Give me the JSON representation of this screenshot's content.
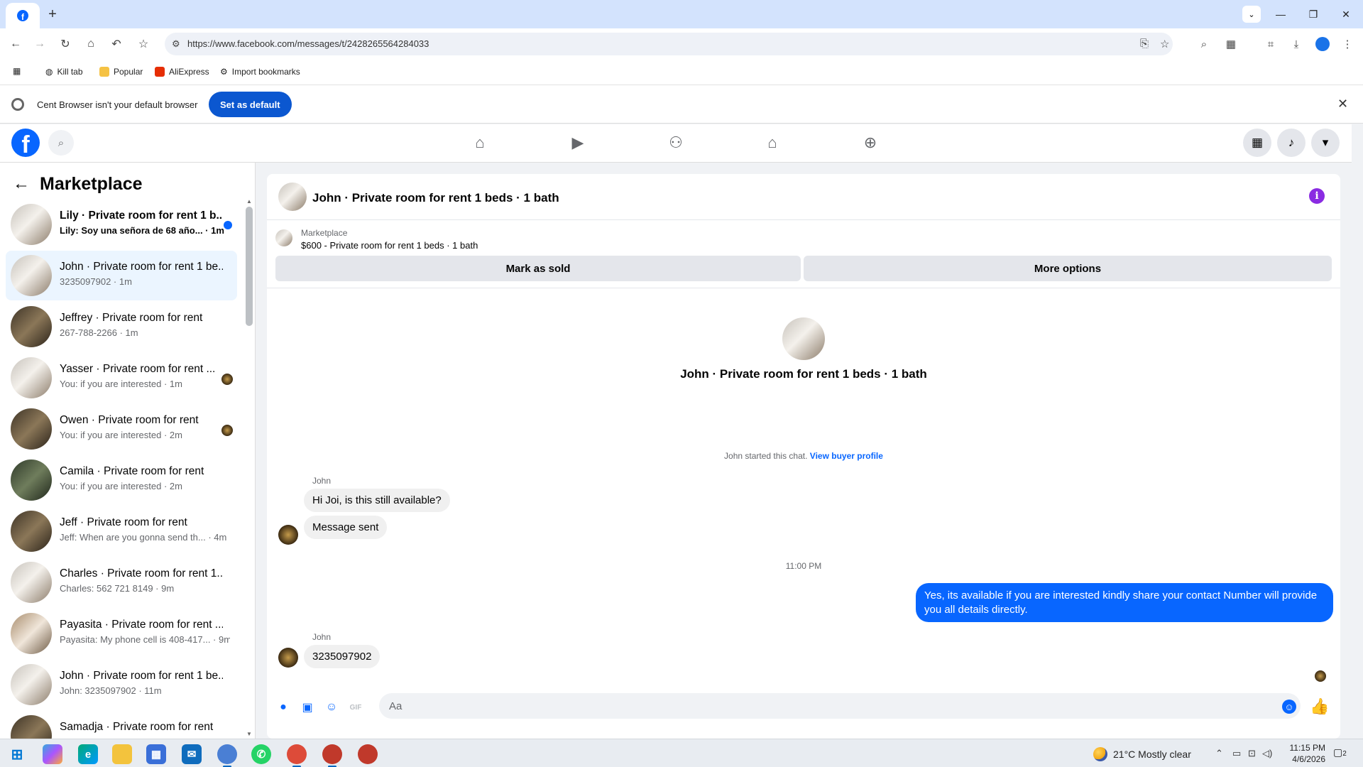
{
  "browser": {
    "url": "https://www.facebook.com/messages/t/24282655642840​33",
    "bookmarks": [
      "Kill tab",
      "Popular",
      "AliExpress",
      "Import bookmarks"
    ],
    "infobar_message": "Cent Browser isn't your default browser",
    "infobar_button": "Set as default"
  },
  "sidebar": {
    "title": "Marketplace",
    "conversations": [
      {
        "title": "Lily · Private room for rent 1 b...",
        "subtitle": "Lily: Soy una señora de 68 año... · 1m"
      },
      {
        "title": "John · Private room for rent 1 be...",
        "subtitle": "3235097902 · 1m"
      },
      {
        "title": "Jeffrey · Private room for rent",
        "subtitle": "267-788-2266 · 1m"
      },
      {
        "title": "Yasser · Private room for rent ...",
        "subtitle": "You: if you are interested · 1m"
      },
      {
        "title": "Owen · Private room for rent",
        "subtitle": "You: if you are interested · 2m"
      },
      {
        "title": "Camila · Private room for rent",
        "subtitle": "You: if you are interested · 2m"
      },
      {
        "title": "Jeff · Private room for rent",
        "subtitle": "Jeff: When are you gonna send th... · 4m"
      },
      {
        "title": "Charles · Private room for rent 1...",
        "subtitle": "Charles: 562 721 8149 · 9m"
      },
      {
        "title": "Payasita · Private room for rent ...",
        "subtitle": "Payasita: My phone cell is 408-417... · 9m"
      },
      {
        "title": "John · Private room for rent 1 be...",
        "subtitle": "John: 3235097902 · 11m"
      },
      {
        "title": "Samadja · Private room for rent",
        "subtitle": ""
      }
    ]
  },
  "chat": {
    "header_title": "John · Private room for rent 1 beds · 1 bath",
    "marketplace_label": "Marketplace",
    "listing": "$600 - Private room for rent 1 beds · 1 bath",
    "mark_sold": "Mark as sold",
    "more_options": "More options",
    "center_title": "John · Private room for rent 1 beds · 1 bath",
    "started_text": "John started this chat. ",
    "view_profile": "View buyer profile",
    "sender_name": "John",
    "msg1": "Hi Joi, is this still available?",
    "msg2": "Message sent",
    "timestamp": "11:00 PM",
    "msg_out": "Yes, its available if you are interested kindly share your contact Number will provide you all details directly.",
    "msg3": "3235097902",
    "composer_placeholder": "Aa"
  },
  "taskbar": {
    "weather": "21°C  Mostly clear",
    "time": "11:15 PM",
    "date": "4/6/2026",
    "notifications": "2"
  }
}
